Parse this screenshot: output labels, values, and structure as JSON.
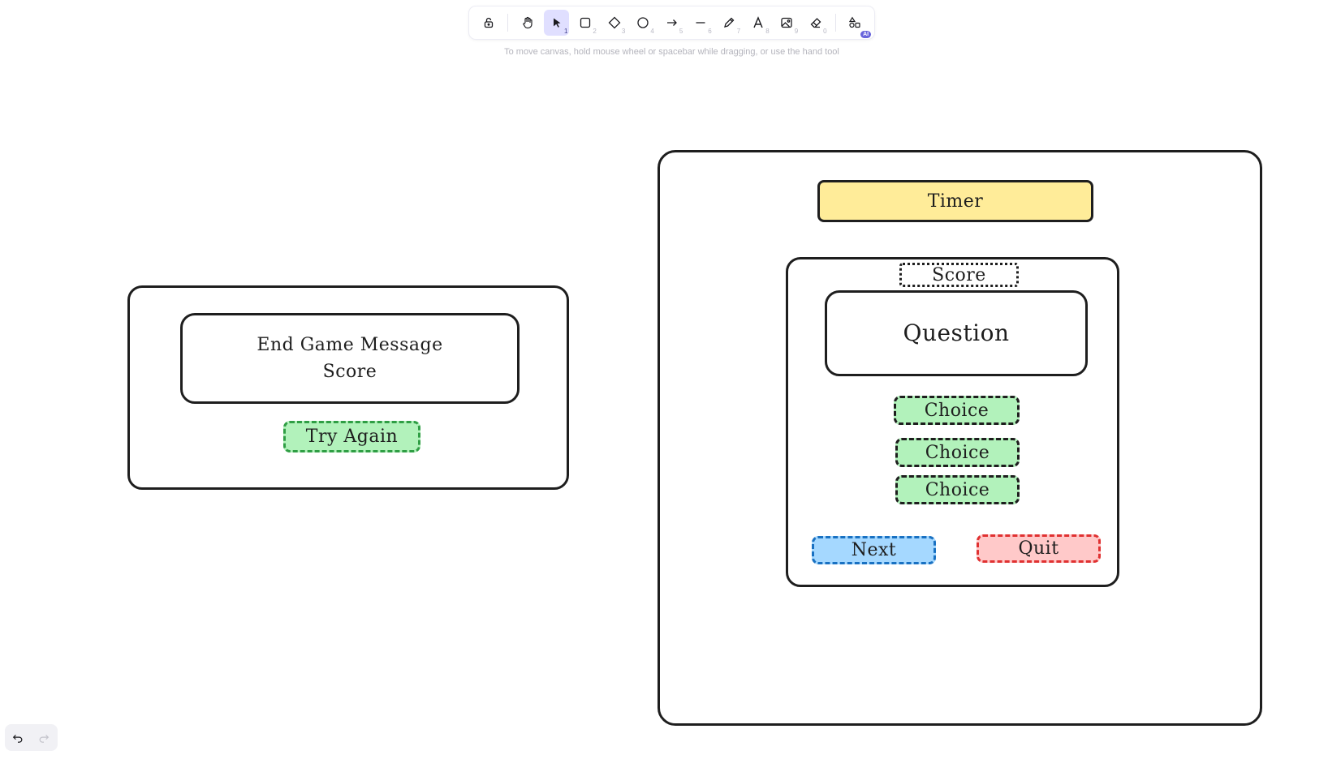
{
  "toolbar": {
    "tools": [
      {
        "name": "lock",
        "key": ""
      },
      {
        "name": "hand",
        "key": ""
      },
      {
        "name": "selection",
        "key": "1"
      },
      {
        "name": "rectangle",
        "key": "2"
      },
      {
        "name": "diamond",
        "key": "3"
      },
      {
        "name": "ellipse",
        "key": "4"
      },
      {
        "name": "arrow",
        "key": "5"
      },
      {
        "name": "line",
        "key": "6"
      },
      {
        "name": "draw",
        "key": "7"
      },
      {
        "name": "text",
        "key": "8"
      },
      {
        "name": "image",
        "key": "9"
      },
      {
        "name": "eraser",
        "key": "0"
      },
      {
        "name": "more-tools",
        "key": ""
      }
    ],
    "active_tool": "selection",
    "ai_badge": "AI"
  },
  "hint": "To move canvas, hold mouse wheel or spacebar while dragging, or use the hand tool",
  "canvas": {
    "end_screen": {
      "message": "End Game Message",
      "score": "Score",
      "try_again": "Try Again"
    },
    "game_screen": {
      "timer": "Timer",
      "score": "Score",
      "question": "Question",
      "choices": [
        "Choice",
        "Choice",
        "Choice"
      ],
      "next": "Next",
      "quit": "Quit"
    }
  },
  "colors": {
    "stroke": "#1e1e1e",
    "yellow_fill": "#ffec99",
    "green_fill": "#b2f2bb",
    "green_stroke": "#2f9e44",
    "blue_fill": "#a5d8ff",
    "blue_stroke": "#1971c2",
    "red_fill": "#ffc9c9",
    "red_stroke": "#e03131",
    "active_tool_bg": "#e0dfff"
  }
}
